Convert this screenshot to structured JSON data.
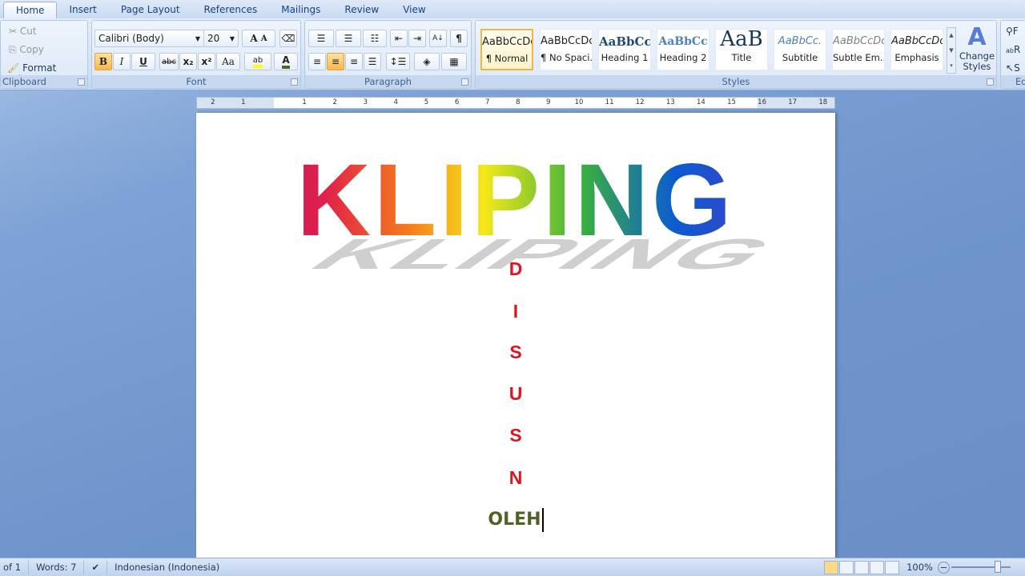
{
  "tabs": [
    "Home",
    "Insert",
    "Page Layout",
    "References",
    "Mailings",
    "Review",
    "View"
  ],
  "clipboard": {
    "cut": "Cut",
    "copy": "Copy",
    "format_painter": "Format Painter",
    "label": "Clipboard"
  },
  "font": {
    "name": "Calibri (Body)",
    "size": "20",
    "label": "Font",
    "bold": "B",
    "italic": "I",
    "underline": "U",
    "strike": "abc",
    "sub": "x₂",
    "sup": "x²",
    "case": "Aa",
    "grow": "A",
    "shrink": "A"
  },
  "paragraph": {
    "label": "Paragraph",
    "pilcrow": "¶"
  },
  "styles": {
    "label": "Styles",
    "items": [
      {
        "preview": "AaBbCcDc",
        "name": "¶ Normal"
      },
      {
        "preview": "AaBbCcDc",
        "name": "¶ No Spaci..."
      },
      {
        "preview": "AaBbCc",
        "name": "Heading 1"
      },
      {
        "preview": "AaBbCc",
        "name": "Heading 2"
      },
      {
        "preview": "AaB",
        "name": "Title"
      },
      {
        "preview": "AaBbCc.",
        "name": "Subtitle"
      },
      {
        "preview": "AaBbCcDc",
        "name": "Subtle Em..."
      },
      {
        "preview": "AaBbCcDc",
        "name": "Emphasis"
      }
    ],
    "change_styles": "Change Styles"
  },
  "editing": {
    "label": "Ed",
    "find": "F",
    "replace": "R",
    "select": "S"
  },
  "ruler": [
    "2",
    "1",
    "1",
    "2",
    "3",
    "4",
    "5",
    "6",
    "7",
    "8",
    "9",
    "10",
    "11",
    "12",
    "13",
    "14",
    "15",
    "16",
    "17",
    "18"
  ],
  "document": {
    "title": "KLIPING",
    "letters": [
      "D",
      "I",
      "S",
      "U",
      "S",
      "N"
    ],
    "oleh": "OLEH"
  },
  "status": {
    "page": "of 1",
    "words": "Words: 7",
    "language": "Indonesian (Indonesia)",
    "zoom": "100%"
  },
  "colors": {
    "letters": "#e0141e",
    "oleh": "#4f6228"
  }
}
